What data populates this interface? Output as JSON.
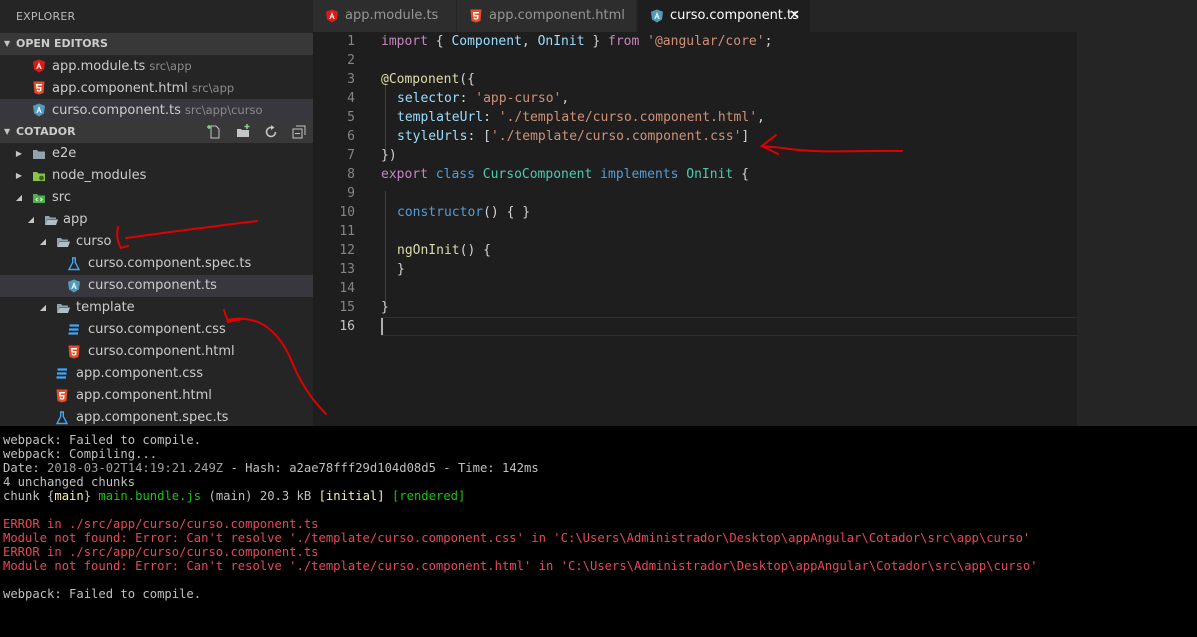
{
  "sidebar": {
    "title": "EXPLORER",
    "open_editors": {
      "header": "OPEN EDITORS",
      "items": [
        {
          "name": "app.module.ts",
          "path": "src\\app",
          "icon": "angular-icon"
        },
        {
          "name": "app.component.html",
          "path": "src\\app",
          "icon": "html5-icon"
        },
        {
          "name": "curso.component.ts",
          "path": "src\\app\\curso",
          "icon": "angular-ts-icon"
        }
      ]
    },
    "project": {
      "header": "COTADOR",
      "toolbar_icons": [
        "new-file-icon",
        "new-folder-icon",
        "refresh-icon",
        "collapse-all-icon"
      ],
      "tree": [
        {
          "label": "e2e",
          "icon": "folder-icon",
          "twisty": "collapsed"
        },
        {
          "label": "node_modules",
          "icon": "node-folder-icon",
          "twisty": "collapsed"
        },
        {
          "label": "src",
          "icon": "src-folder-icon",
          "twisty": "expanded"
        },
        {
          "label": "app",
          "icon": "folder-open-icon",
          "twisty": "expanded"
        },
        {
          "label": "curso",
          "icon": "folder-open-icon",
          "twisty": "expanded"
        },
        {
          "label": "curso.component.spec.ts",
          "icon": "test-flask-icon"
        },
        {
          "label": "curso.component.ts",
          "icon": "angular-ts-icon"
        },
        {
          "label": "template",
          "icon": "folder-open-icon",
          "twisty": "expanded"
        },
        {
          "label": "curso.component.css",
          "icon": "css3-icon"
        },
        {
          "label": "curso.component.html",
          "icon": "html5-icon"
        },
        {
          "label": "app.component.css",
          "icon": "css3-icon"
        },
        {
          "label": "app.component.html",
          "icon": "html5-icon"
        },
        {
          "label": "app.component.spec.ts",
          "icon": "test-flask-icon"
        }
      ]
    }
  },
  "tabs": [
    {
      "label": "app.module.ts",
      "icon": "angular-icon"
    },
    {
      "label": "app.component.html",
      "icon": "html5-icon"
    },
    {
      "label": "curso.component.ts",
      "icon": "angular-ts-icon",
      "active": true,
      "close": "✕"
    }
  ],
  "editor": {
    "line_numbers": [
      "1",
      "2",
      "3",
      "4",
      "5",
      "6",
      "7",
      "8",
      "9",
      "10",
      "11",
      "12",
      "13",
      "14",
      "15",
      "16"
    ],
    "lines": {
      "l1": {
        "kw": "import",
        "p1": " { ",
        "c1": "Component",
        "p2": ", ",
        "c2": "OnInit",
        "p3": " } ",
        "kw2": "from",
        "sp": " ",
        "str": "'@angular/core'",
        "end": ";"
      },
      "l3": {
        "dec": "@Component",
        "end": "({"
      },
      "l4": {
        "prop": "selector",
        "colon": ": ",
        "str": "'app-curso'",
        "end": ","
      },
      "l5": {
        "prop": "templateUrl",
        "colon": ": ",
        "str": "'./template/curso.component.html'",
        "end": ","
      },
      "l6": {
        "prop": "styleUrls",
        "colon": ": [",
        "str": "'./template/curso.component.css'",
        "end": "]"
      },
      "l7": {
        "text": "})"
      },
      "l8": {
        "kw": "export",
        "sp1": " ",
        "kw2": "class",
        "sp2": " ",
        "cls": "CursoComponent",
        "sp3": " ",
        "kw3": "implements",
        "sp4": " ",
        "iface": "OnInit",
        "end": " {"
      },
      "l10": {
        "fn": "constructor",
        "end": "() { }"
      },
      "l12": {
        "fn": "ngOnInit",
        "end": "() {"
      },
      "l13": {
        "text": "}"
      },
      "l15": {
        "text": "}"
      }
    }
  },
  "terminal": {
    "lines": {
      "t1": "webpack: Failed to compile.",
      "t2": "webpack: Compiling...",
      "t3": {
        "a": "Date: ",
        "date": "2018-03-02T14:19:21.249Z",
        "b": " - Hash: ",
        "hash": "a2ae78fff29d104d08d5",
        "c": " - Time: ",
        "time": "142",
        "d": "ms"
      },
      "t4": "4 unchanged chunks",
      "t5": {
        "a": "chunk {",
        "main": "main",
        "b": "} ",
        "bundle": "main.bundle.js",
        "c": " (main) 20.3 kB ",
        "initial": "[initial]",
        "sp": " ",
        "rendered": "[rendered]"
      },
      "t6": "ERROR in ./src/app/curso/curso.component.ts",
      "t7": "Module not found: Error: Can't resolve './template/curso.component.css' in 'C:\\Users\\Administrador\\Desktop\\appAngular\\Cotador\\src\\app\\curso'",
      "t8": "ERROR in ./src/app/curso/curso.component.ts",
      "t9": "Module not found: Error: Can't resolve './template/curso.component.html' in 'C:\\Users\\Administrador\\Desktop\\appAngular\\Cotador\\src\\app\\curso'",
      "t10": "webpack: Failed to compile."
    }
  },
  "colors": {
    "annotation": "#e00000",
    "angular": "#dd1b16",
    "html5": "#e44d26",
    "css3": "#42a5f5",
    "ts_angular": "#519aba"
  }
}
